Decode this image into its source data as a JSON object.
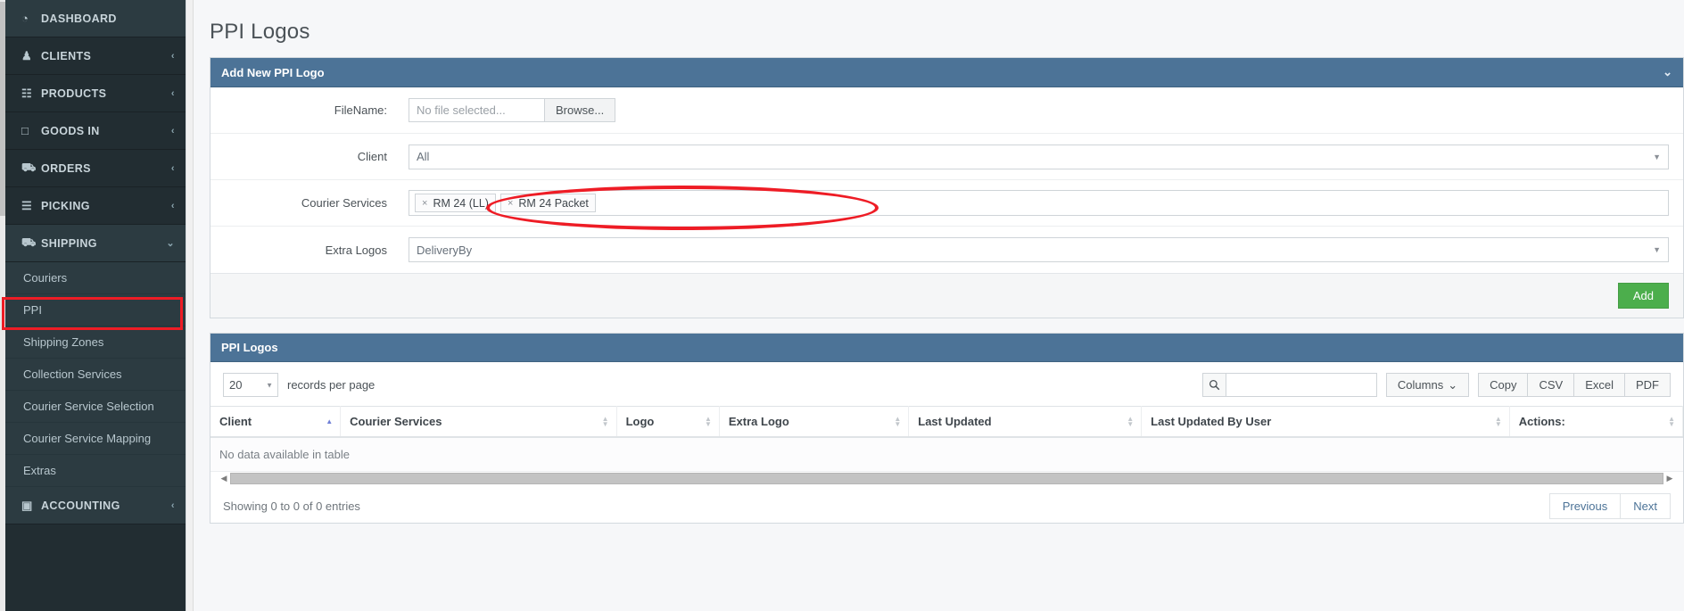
{
  "sidebar": {
    "primary_items": [
      {
        "label": "DASHBOARD",
        "icon": "dashboard-icon",
        "glyph": "◔",
        "caret": "",
        "active": true
      },
      {
        "label": "CLIENTS",
        "icon": "users-icon",
        "glyph": "♟",
        "caret": "‹",
        "active": false
      },
      {
        "label": "PRODUCTS",
        "icon": "grid-icon",
        "glyph": "☷",
        "caret": "‹",
        "active": false
      },
      {
        "label": "GOODS IN",
        "icon": "inbox-icon",
        "glyph": "□",
        "caret": "‹",
        "active": false
      },
      {
        "label": "ORDERS",
        "icon": "cart-icon",
        "glyph": "⛟",
        "caret": "‹",
        "active": false
      },
      {
        "label": "PICKING",
        "icon": "list-icon",
        "glyph": "☰",
        "caret": "‹",
        "active": false
      },
      {
        "label": "SHIPPING",
        "icon": "truck-icon",
        "glyph": "⛟",
        "caret": "⌄",
        "active": true
      }
    ],
    "sub_items": [
      {
        "label": "Couriers",
        "highlighted": false
      },
      {
        "label": "PPI",
        "highlighted": true
      },
      {
        "label": "Shipping Zones",
        "highlighted": false
      },
      {
        "label": "Collection Services",
        "highlighted": false
      },
      {
        "label": "Courier Service Selection",
        "highlighted": false
      },
      {
        "label": "Courier Service Mapping",
        "highlighted": false
      },
      {
        "label": "Extras",
        "highlighted": false
      }
    ],
    "bottom_item": {
      "label": "ACCOUNTING",
      "icon": "calculator-icon",
      "glyph": "▣",
      "caret": "‹"
    }
  },
  "page": {
    "title": "PPI Logos"
  },
  "add_panel": {
    "header": "Add New PPI Logo",
    "collapse_icon": "chevron-down-icon",
    "collapse_glyph": "⌄",
    "rows": {
      "filename": {
        "label": "FileName:",
        "placeholder": "No file selected...",
        "value": "",
        "browse_label": "Browse..."
      },
      "client": {
        "label": "Client",
        "value": "All"
      },
      "courier_services": {
        "label": "Courier Services",
        "tags": [
          {
            "label": "RM 24 (LL)",
            "remove_glyph": "×"
          },
          {
            "label": "RM 24 Packet",
            "remove_glyph": "×"
          }
        ]
      },
      "extra_logos": {
        "label": "Extra Logos",
        "value": "DeliveryBy"
      }
    },
    "add_button": "Add",
    "add_button_color": "#4cae4c"
  },
  "table_panel": {
    "header": "PPI Logos",
    "records_per_page_value": "20",
    "records_per_page_label": "records per page",
    "search": {
      "icon": "search-icon",
      "value": "",
      "placeholder": ""
    },
    "buttons": {
      "columns": "Columns",
      "columns_caret": "⌄",
      "export": [
        "Copy",
        "CSV",
        "Excel",
        "PDF"
      ]
    },
    "columns": [
      {
        "label": "Client",
        "sorted": "asc"
      },
      {
        "label": "Courier Services",
        "sorted": "none"
      },
      {
        "label": "Logo",
        "sorted": "none"
      },
      {
        "label": "Extra Logo",
        "sorted": "none"
      },
      {
        "label": "Last Updated",
        "sorted": "none"
      },
      {
        "label": "Last Updated By User",
        "sorted": "none"
      },
      {
        "label": "Actions:",
        "sorted": "none"
      }
    ],
    "empty_message": "No data available in table",
    "footer_text": "Showing 0 to 0 of 0 entries",
    "pagination": {
      "previous": "Previous",
      "next": "Next"
    }
  },
  "annotations": {
    "ellipse_target": "courier-services-field",
    "box_target": "sidebar-item-ppi",
    "color": "#ee1c25"
  }
}
